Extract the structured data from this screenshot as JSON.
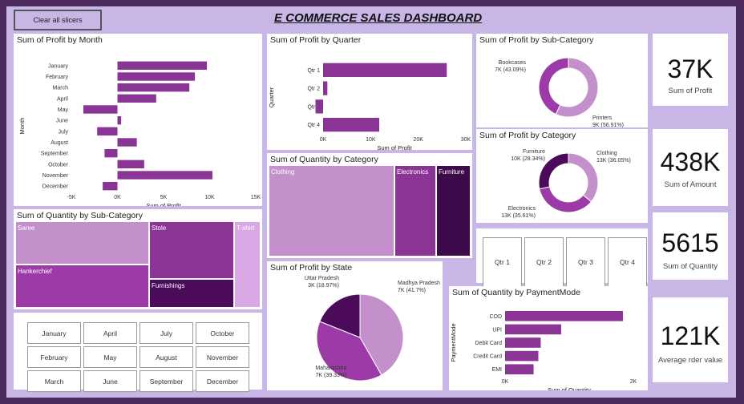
{
  "dashboard": {
    "title": "E COMMERCE SALES DASHBOARD",
    "clear_label": "Clear all slicers"
  },
  "colors": {
    "bar": "#8a3595",
    "dark": "#4b0a5a",
    "mid": "#9c3ba8",
    "light": "#c390cc",
    "lighter": "#d9a7e3"
  },
  "kpis": [
    {
      "value": "37K",
      "label": "Sum of Profit"
    },
    {
      "value": "438K",
      "label": "Sum of Amount"
    },
    {
      "value": "5615",
      "label": "Sum of Quantity"
    },
    {
      "value": "121K",
      "label": "Average rder value"
    }
  ],
  "quarter_slicer": [
    "Qtr 1",
    "Qtr 2",
    "Qtr 3",
    "Qtr 4"
  ],
  "month_slicer": [
    "January",
    "April",
    "July",
    "October",
    "February",
    "May",
    "August",
    "November",
    "March",
    "June",
    "September",
    "December"
  ],
  "chart_data": [
    {
      "type": "bar",
      "title": "Sum of Profit by Month",
      "categories": [
        "January",
        "February",
        "March",
        "April",
        "May",
        "June",
        "July",
        "August",
        "September",
        "October",
        "November",
        "December"
      ],
      "values": [
        9700,
        8400,
        7800,
        4200,
        -3700,
        400,
        -2200,
        2100,
        -1400,
        2900,
        10300,
        -1600
      ],
      "xlabel": "Sum of Profit",
      "ylabel": "Month",
      "xlim": [
        -5000,
        15000
      ],
      "ticks": [
        "-5K",
        "0K",
        "5K",
        "10K",
        "15K"
      ]
    },
    {
      "type": "bar",
      "title": "Sum of Profit by Quarter",
      "categories": [
        "Qtr 1",
        "Qtr 2",
        "Qtr 3",
        "Qtr 4"
      ],
      "values": [
        26000,
        900,
        -1600,
        11800
      ],
      "xlabel": "Sum of Profit",
      "ylabel": "Quarter",
      "xlim": [
        0,
        30000
      ],
      "ticks": [
        "0K",
        "10K",
        "20K",
        "30K"
      ]
    },
    {
      "type": "pie",
      "title": "Sum of Profit by Sub-Category",
      "categories": [
        "Bookcases",
        "Printers"
      ],
      "values": [
        43.09,
        56.91
      ],
      "labels": [
        "7K (43.09%)",
        "9K (56.91%)"
      ]
    },
    {
      "type": "pie",
      "title": "Sum of Profit by Category",
      "categories": [
        "Clothing",
        "Electronics",
        "Furniture"
      ],
      "values": [
        36.05,
        35.61,
        28.34
      ],
      "labels": [
        "13K (36.05%)",
        "13K (35.61%)",
        "10K (28.34%)"
      ]
    },
    {
      "type": "heatmap",
      "title": "Sum of Quantity by Sub-Category",
      "categories": [
        "Saree",
        "Hankerchief",
        "Stole",
        "Furnishings",
        "T-shirt"
      ]
    },
    {
      "type": "heatmap",
      "title": "Sum of Quantity by Category",
      "categories": [
        "Clothing",
        "Electronics",
        "Furniture"
      ]
    },
    {
      "type": "pie",
      "title": "Sum of Profit by State",
      "categories": [
        "Madhya Pradesh",
        "Maharashtra",
        "Uttar Pradesh"
      ],
      "values": [
        41.7,
        39.33,
        18.97
      ],
      "labels": [
        "7K (41.7%)",
        "7K (39.33%)",
        "3K (18.97%)"
      ]
    },
    {
      "type": "bar",
      "title": "Sum of Quantity by PaymentMode",
      "categories": [
        "COD",
        "UPI",
        "Debit Card",
        "Credit Card",
        "EMI"
      ],
      "values": [
        2480,
        1180,
        750,
        700,
        600
      ],
      "xlabel": "Sum of Quantity",
      "ylabel": "PaymentMode",
      "xlim": [
        0,
        2700
      ],
      "ticks": [
        "0K",
        "2K"
      ]
    }
  ]
}
